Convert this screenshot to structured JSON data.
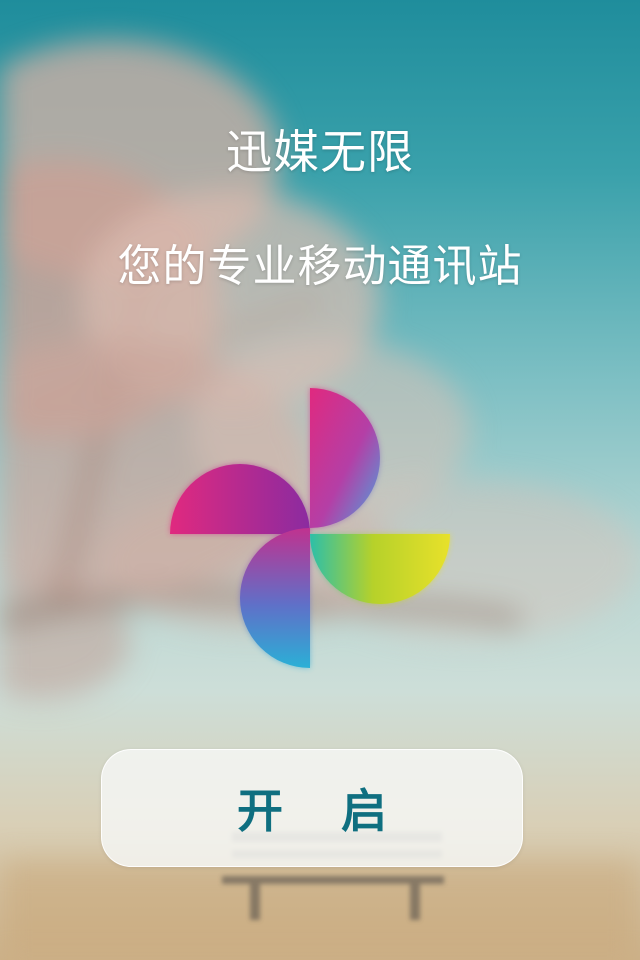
{
  "app": {
    "title": "迅媒无限",
    "tagline": "您的专业移动通讯站"
  },
  "logo": {
    "icon": "pinwheel-logo-icon",
    "colors": [
      "#e0297f",
      "#9b2ca0",
      "#2bb0d6",
      "#b6d12a",
      "#e8e12a"
    ]
  },
  "start_button": {
    "label": "开启",
    "text_color": "#0f6f80"
  },
  "background": {
    "description_icon": "blossom-tree-bench-background"
  }
}
